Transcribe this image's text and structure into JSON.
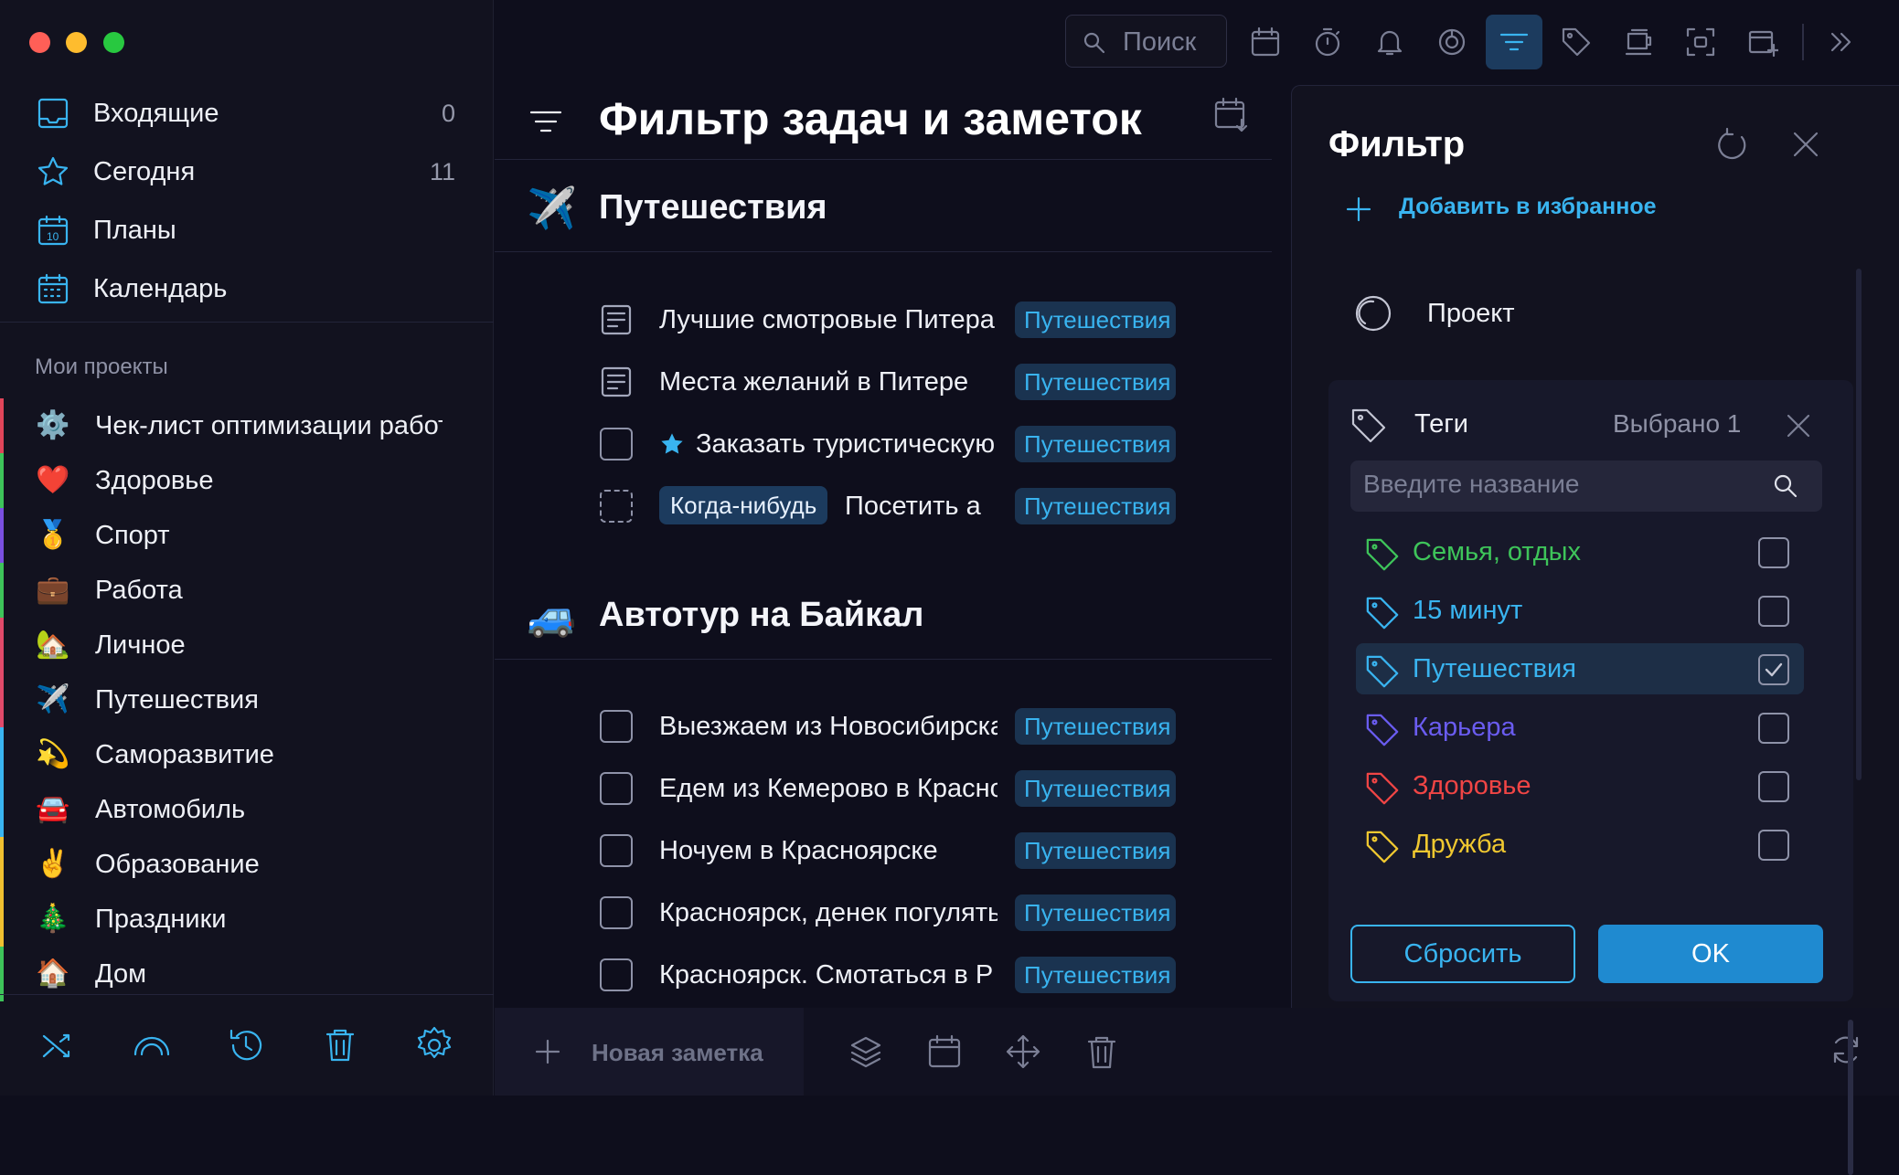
{
  "sidebar": {
    "nav": [
      {
        "label": "Входящие",
        "count": "0",
        "icon": "inbox-icon"
      },
      {
        "label": "Сегодня",
        "count": "11",
        "icon": "star-icon"
      },
      {
        "label": "Планы",
        "count": "",
        "icon": "calendar-10-icon"
      },
      {
        "label": "Календарь",
        "count": "",
        "icon": "calendar-grid-icon"
      }
    ],
    "projects_heading": "Мои проекты",
    "projects": [
      {
        "label": "Чек-лист оптимизации работы",
        "emoji": "⚙️",
        "color": "#e0455a"
      },
      {
        "label": "Здоровье",
        "emoji": "❤️",
        "color": "#3ec45a"
      },
      {
        "label": "Спорт",
        "emoji": "🥇",
        "color": "#7a4fe0"
      },
      {
        "label": "Работа",
        "emoji": "💼",
        "color": "#3ec45a"
      },
      {
        "label": "Личное",
        "emoji": "🏡",
        "color": "#e04a6a"
      },
      {
        "label": "Путешествия",
        "emoji": "✈️",
        "color": "#e04a6a"
      },
      {
        "label": "Саморазвитие",
        "emoji": "💫",
        "color": "#39b4f0"
      },
      {
        "label": "Автомобиль",
        "emoji": "🚘",
        "color": "#39b4f0"
      },
      {
        "label": "Образование",
        "emoji": "✌️",
        "color": "#f0c030"
      },
      {
        "label": "Праздники",
        "emoji": "🎄",
        "color": "#f0c030"
      },
      {
        "label": "Дом",
        "emoji": "🏠",
        "color": "#3ec45a"
      }
    ],
    "bottom_icons": [
      "shuffle-icon",
      "rainbow-icon",
      "history-icon",
      "trash-icon",
      "gear-icon"
    ]
  },
  "toolbar": {
    "search_placeholder": "Поиск",
    "icons": [
      "calendar-icon",
      "timer-icon",
      "bell-icon",
      "focus-icon",
      "filter-icon",
      "tag-icon",
      "mug-icon",
      "screenshot-icon",
      "add-window-icon",
      "chevrons-right-icon"
    ],
    "active": "filter-icon"
  },
  "main": {
    "title": "Фильтр задач и заметок",
    "sections": [
      {
        "title": "Путешествия",
        "emoji": "✈️",
        "tasks": [
          {
            "text": "Лучшие смотровые Питера",
            "type": "note",
            "tag": "Путешествия"
          },
          {
            "text": "Места желаний в Питере",
            "type": "note",
            "tag": "Путешествия"
          },
          {
            "text": "Заказать туристическую",
            "type": "task-starred",
            "tag": "Путешествия"
          },
          {
            "text": "Посетить а",
            "type": "someday",
            "badge": "Когда-нибудь",
            "tag": "Путешествия"
          }
        ]
      },
      {
        "title": "Автотур на Байкал",
        "emoji": "🚙",
        "tasks": [
          {
            "text": "Выезжаем из Новосибирска",
            "type": "task",
            "tag": "Путешествия"
          },
          {
            "text": "Едем из Кемерово в Красноярск",
            "type": "task",
            "tag": "Путешествия"
          },
          {
            "text": "Ночуем в Красноярске",
            "type": "task",
            "tag": "Путешествия"
          },
          {
            "text": "Красноярск, денек погулять",
            "type": "task",
            "tag": "Путешествия"
          },
          {
            "text": "Красноярск. Смотаться в Р",
            "type": "task",
            "tag": "Путешествия"
          }
        ]
      }
    ],
    "new_note": "Новая заметка"
  },
  "filter": {
    "title": "Фильтр",
    "add_favorite": "Добавить в избранное",
    "project_label": "Проект",
    "tags_label": "Теги",
    "tags_selected": "Выбрано 1",
    "tag_search_placeholder": "Введите название",
    "tags": [
      {
        "name": "Семья, отдых",
        "color": "#3ec45a",
        "checked": false
      },
      {
        "name": "15 минут",
        "color": "#39b4f0",
        "checked": false
      },
      {
        "name": "Путешествия",
        "color": "#39b4f0",
        "checked": true
      },
      {
        "name": "Карьера",
        "color": "#6a5cf0",
        "checked": false
      },
      {
        "name": "Здоровье",
        "color": "#f04545",
        "checked": false
      },
      {
        "name": "Дружба",
        "color": "#f0c830",
        "checked": false
      }
    ],
    "reset_label": "Сбросить",
    "ok_label": "OK"
  }
}
